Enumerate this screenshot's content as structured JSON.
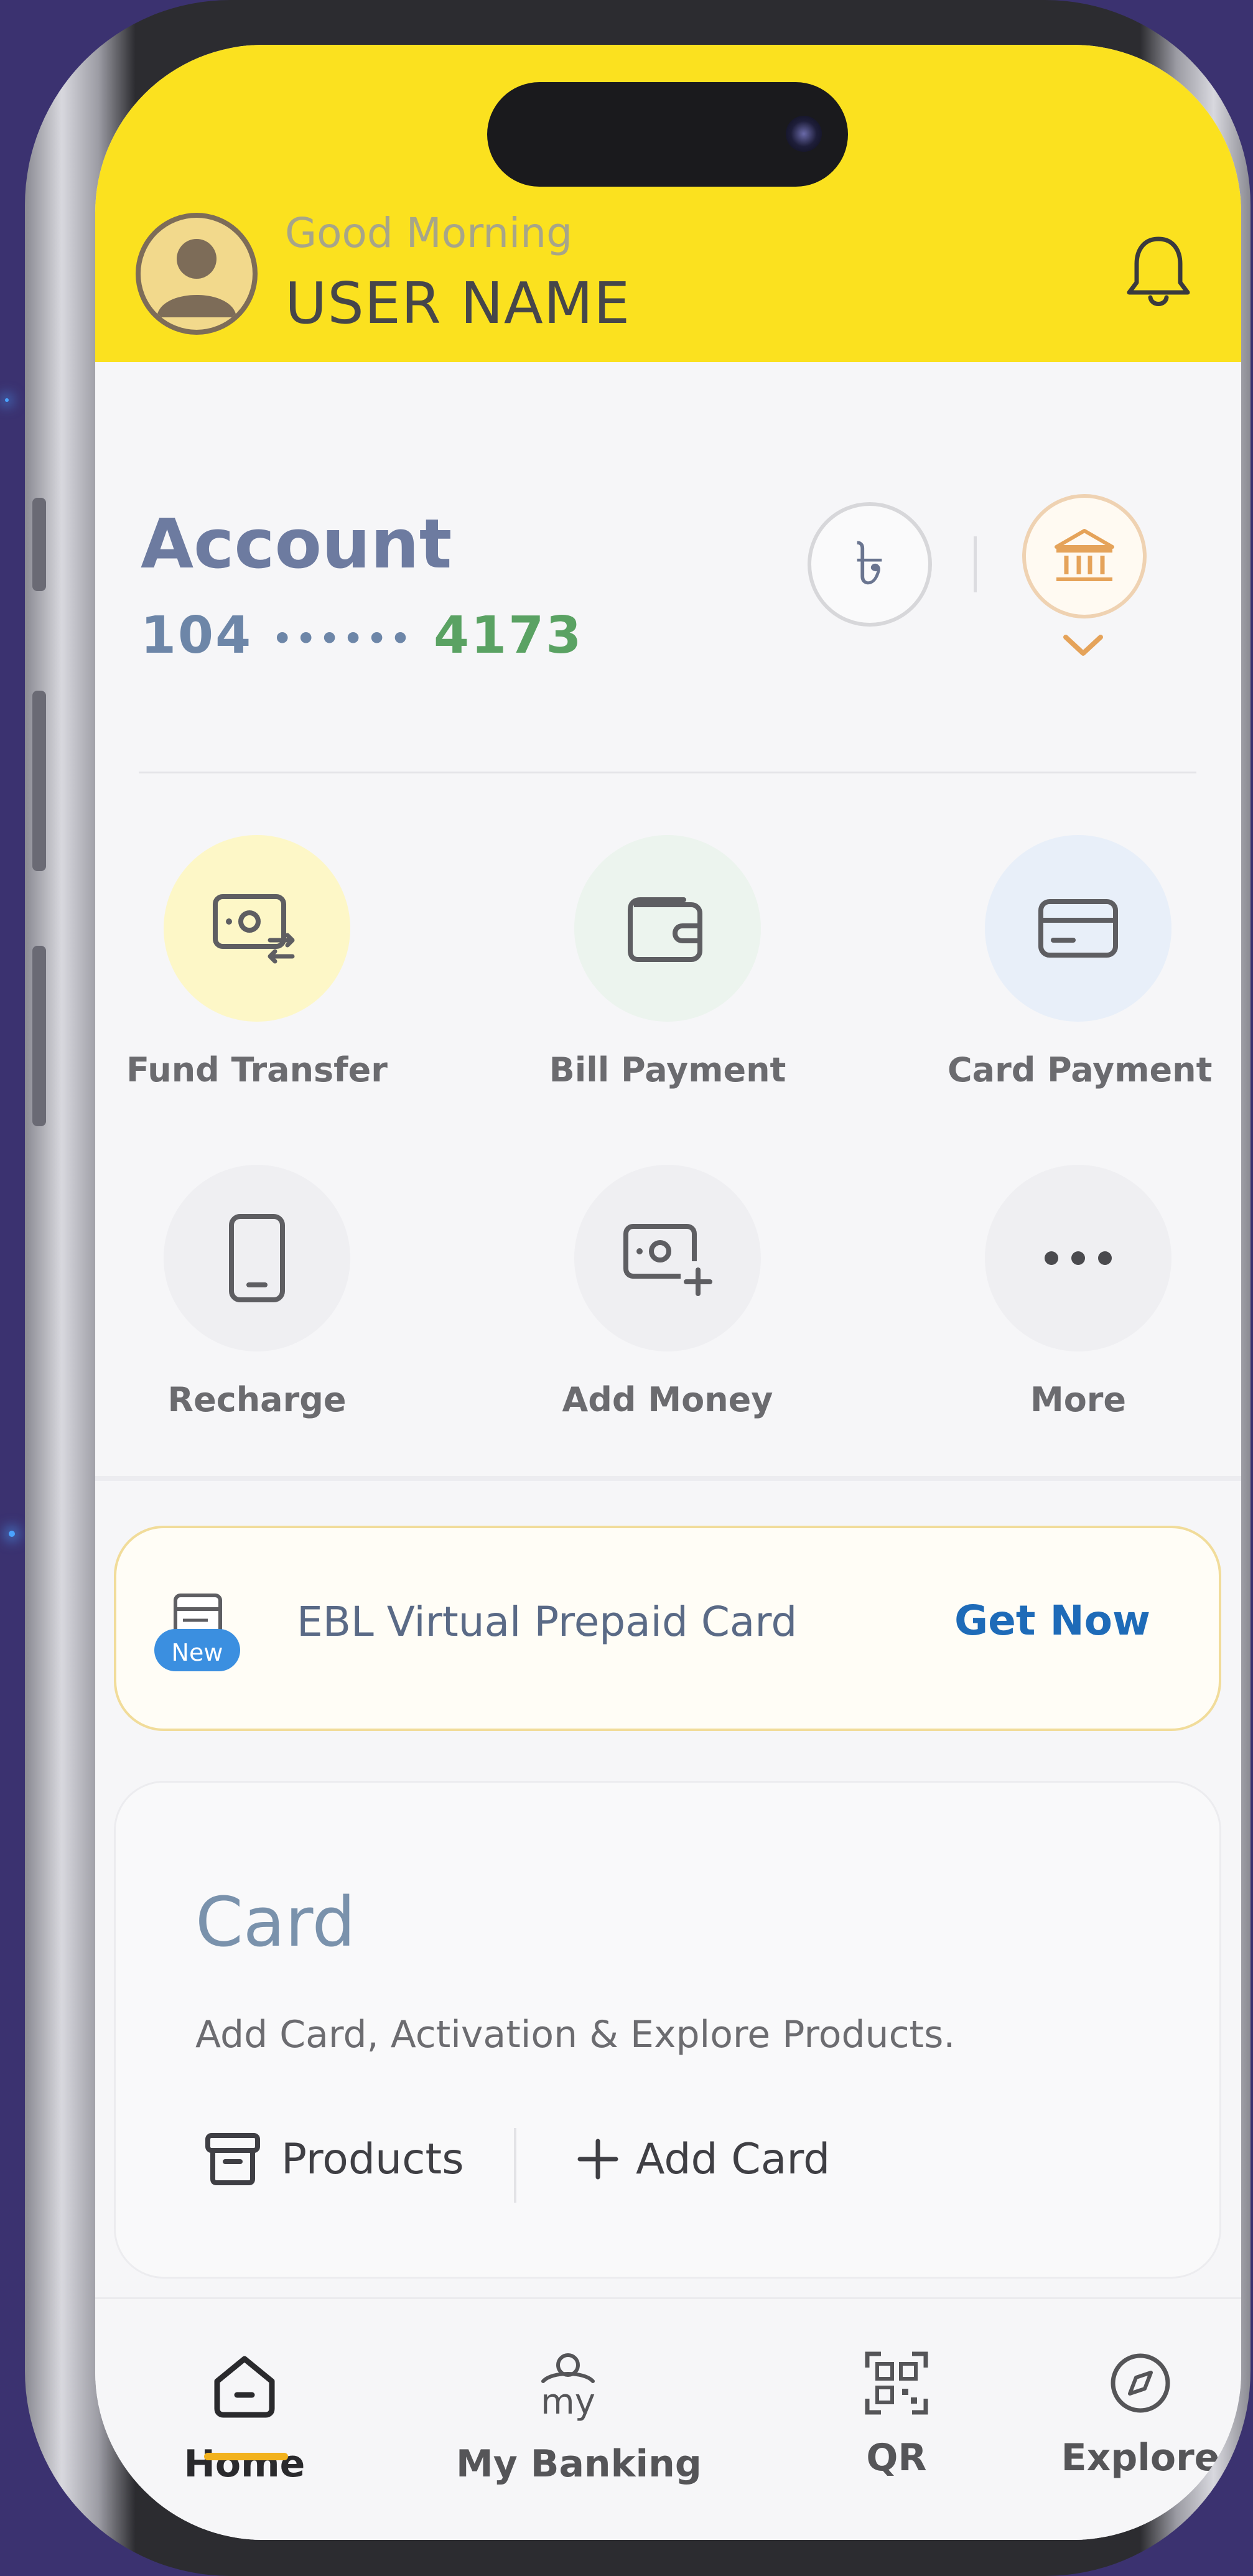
{
  "header": {
    "greeting": "Good Morning",
    "username": "USER NAME"
  },
  "account": {
    "title": "Account",
    "number_prefix": "104",
    "number_mask": "••••••",
    "number_suffix": "4173",
    "currency_symbol": "৳"
  },
  "actions": [
    {
      "label": "Fund Transfer",
      "icon": "fund-transfer-icon",
      "bg": "#fdf7c7"
    },
    {
      "label": "Bill Payment",
      "icon": "wallet-icon",
      "bg": "#ecf4ee"
    },
    {
      "label": "Card Payment",
      "icon": "credit-card-icon",
      "bg": "#e8eff9"
    },
    {
      "label": "Recharge",
      "icon": "mobile-phone-icon",
      "bg": "#efeff2"
    },
    {
      "label": "Add Money",
      "icon": "add-money-icon",
      "bg": "#efeff2"
    },
    {
      "label": "More",
      "icon": "more-dots-icon",
      "bg": "#efeff2"
    }
  ],
  "promo": {
    "badge": "New",
    "text": "EBL Virtual Prepaid Card",
    "cta": "Get Now"
  },
  "card_section": {
    "title": "Card",
    "subtitle": "Add Card, Activation & Explore Products.",
    "products_label": "Products",
    "add_card_label": "Add Card"
  },
  "nav": [
    {
      "label": "Home",
      "icon": "home-icon",
      "active": true
    },
    {
      "label": "My Banking",
      "icon": "my-banking-icon",
      "active": false
    },
    {
      "label": "QR",
      "icon": "qr-code-icon",
      "active": false
    },
    {
      "label": "Explore",
      "icon": "compass-icon",
      "active": false
    }
  ],
  "colors": {
    "header_yellow": "#fbe11f",
    "accent_green": "#5aa263",
    "link_blue": "#1e6bb8",
    "nav_indicator": "#f2b21e"
  }
}
